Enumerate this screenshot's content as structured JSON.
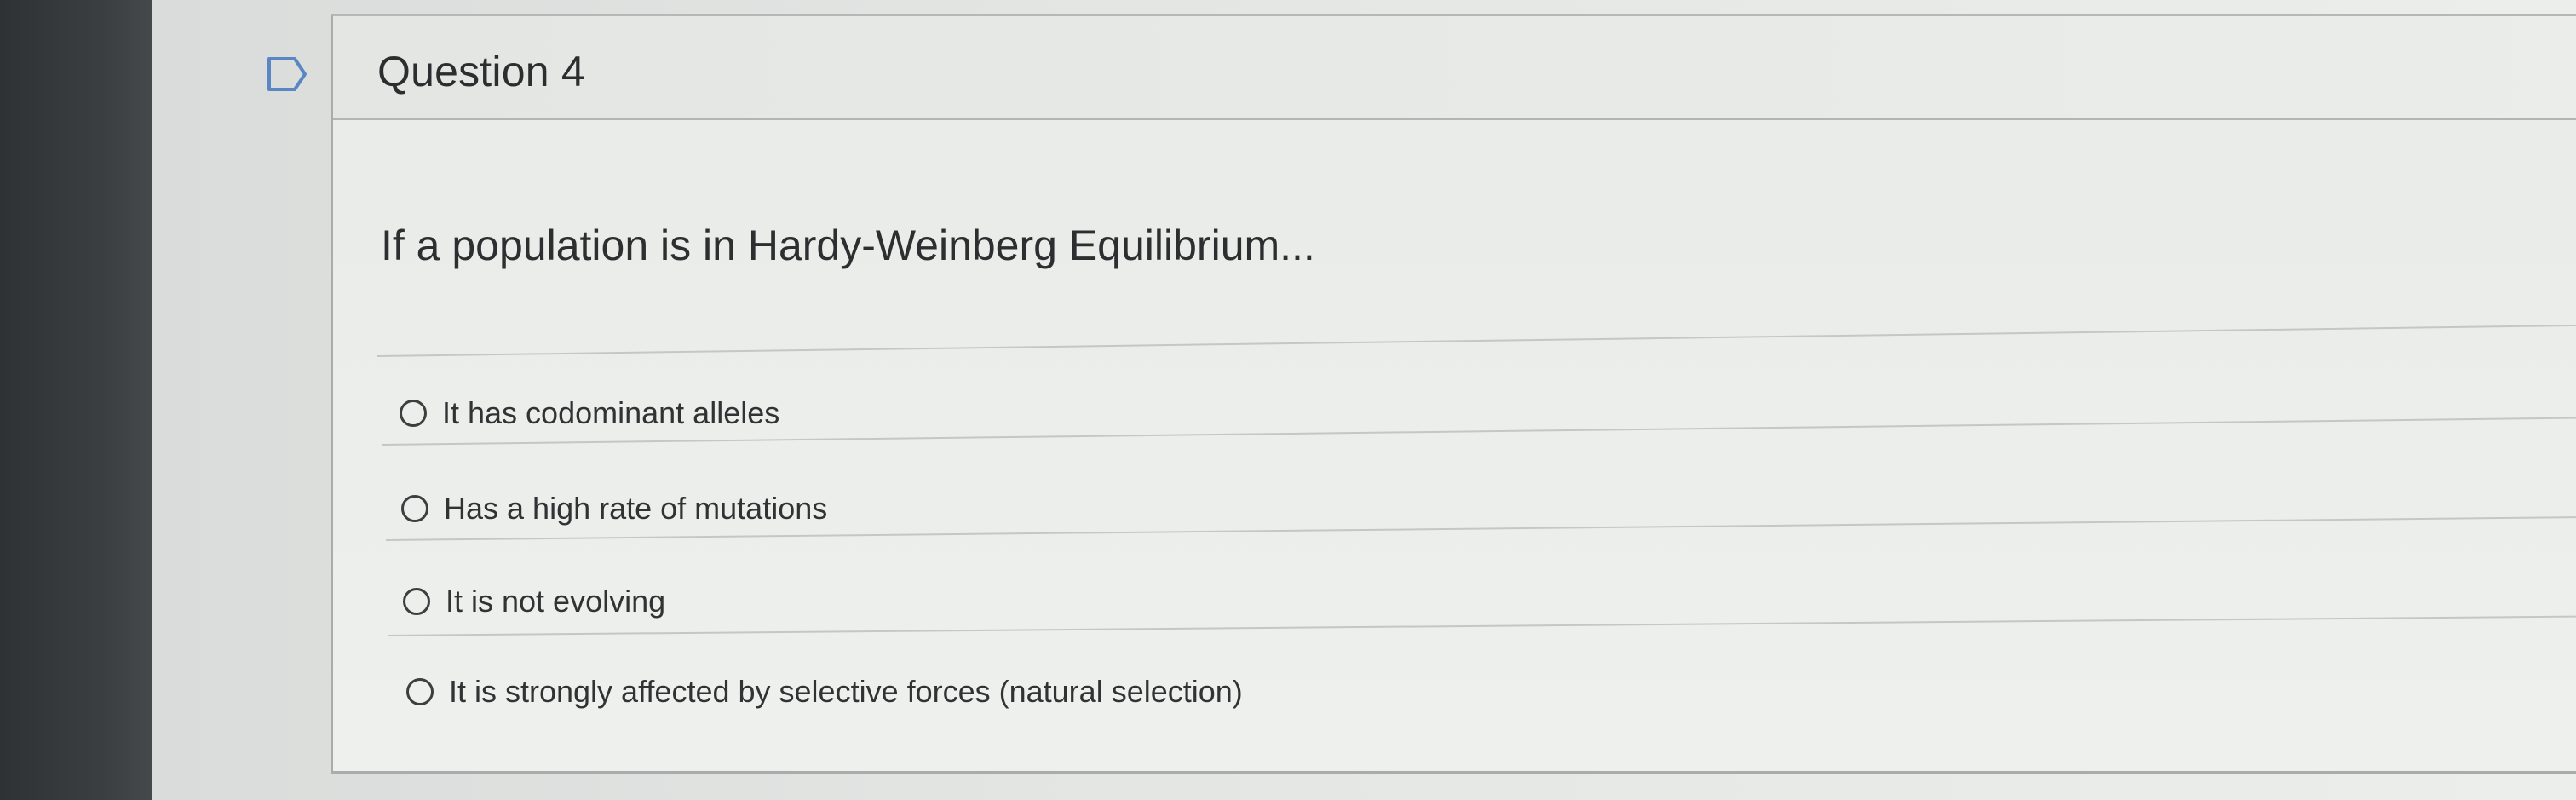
{
  "question": {
    "title": "Question 4",
    "prompt": "If a population is in Hardy-Weinberg Equilibrium...",
    "flag_icon": "flag-question-icon",
    "answers": [
      {
        "label": "It has codominant alleles",
        "selected": false
      },
      {
        "label": "Has a high rate of mutations",
        "selected": false
      },
      {
        "label": "It is not evolving",
        "selected": false
      },
      {
        "label": "It is strongly affected by selective forces (natural selection)",
        "selected": false
      }
    ]
  }
}
